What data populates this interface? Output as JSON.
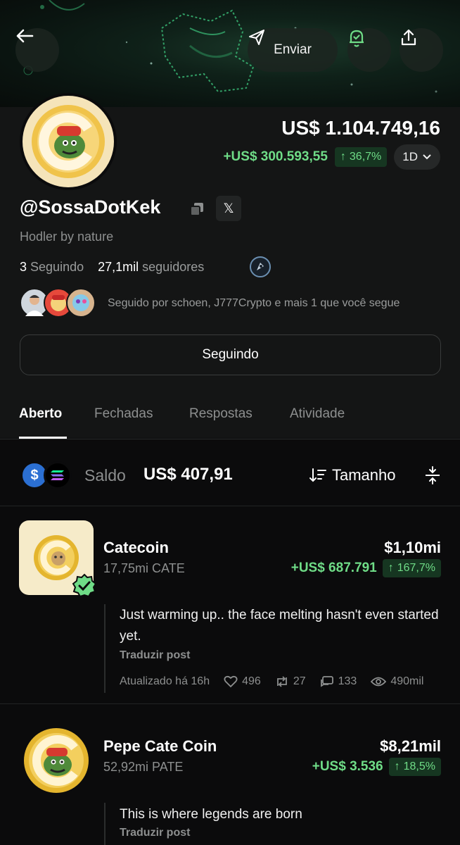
{
  "nav": {
    "send_label": "Enviar"
  },
  "profile": {
    "balance": "US$ 1.104.749,16",
    "pnl": "+US$ 300.593,55",
    "pnl_pct": "36,7%",
    "period": "1D",
    "handle": "@SossaDotKek",
    "bio": "Hodler by nature",
    "following_count": "3",
    "following_label": "Seguindo",
    "followers_count": "27,1mil",
    "followers_label": "seguidores",
    "followed_by": "Seguido por schoen, J777Crypto e mais 1 que você segue",
    "follow_button": "Seguindo"
  },
  "tabs": [
    "Aberto",
    "Fechadas",
    "Respostas",
    "Atividade"
  ],
  "holdings": {
    "saldo_label": "Saldo",
    "saldo_value": "US$ 407,91",
    "sort_label": "Tamanho"
  },
  "positions": [
    {
      "name": "Catecoin",
      "qty": "17,75mi CATE",
      "value": "$1,10mi",
      "pnl": "+US$ 687.791",
      "pct": "167,7%",
      "post": "Just warming up.. the face melting hasn't even started yet.",
      "translate": "Traduzir post",
      "updated": "Atualizado há 16h",
      "likes": "496",
      "reposts": "27",
      "comments": "133",
      "views": "490mil"
    },
    {
      "name": "Pepe Cate Coin",
      "qty": "52,92mi PATE",
      "value": "$8,21mil",
      "pnl": "+US$ 3.536",
      "pct": "18,5%",
      "post": "This is where legends are born",
      "translate": "Traduzir post"
    }
  ],
  "colors": {
    "positive": "#6fdc87",
    "background": "#0b0b0c",
    "panel": "#141515",
    "usdc": "#2b6fd2"
  }
}
